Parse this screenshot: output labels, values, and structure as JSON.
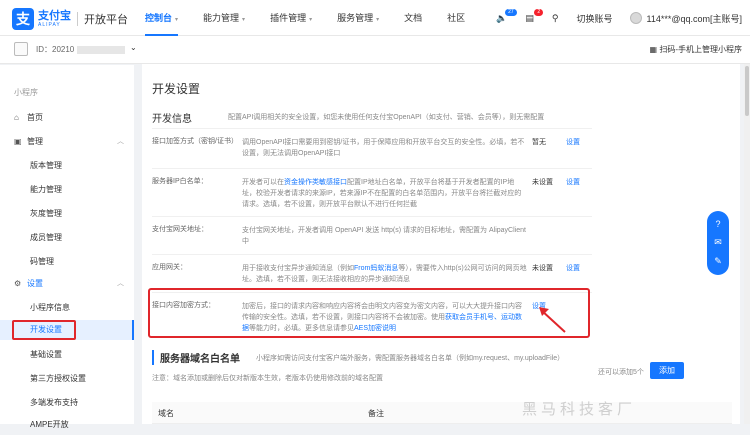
{
  "brand": {
    "name_cn": "支付宝",
    "name_en": "ALIPAY",
    "platform": "开放平台",
    "color": "#1677ff"
  },
  "nav": {
    "items": [
      {
        "label": "控制台",
        "active": true
      },
      {
        "label": "能力管理"
      },
      {
        "label": "插件管理"
      },
      {
        "label": "服务管理"
      },
      {
        "label": "文档"
      },
      {
        "label": "社区"
      }
    ]
  },
  "tools": {
    "notify_count": "27",
    "message_count": "2",
    "switch_account": "切换账号",
    "account": "114***@qq.com[主账号]"
  },
  "app": {
    "id_label": "ID：20210",
    "scan_label": "扫码-手机上管理小程序"
  },
  "sidebar": {
    "section": "小程序",
    "items": [
      {
        "label": "首页",
        "icon": "home-icon"
      },
      {
        "label": "管理",
        "icon": "briefcase-icon"
      },
      {
        "label": "版本管理"
      },
      {
        "label": "能力管理"
      },
      {
        "label": "灰度管理"
      },
      {
        "label": "成员管理"
      },
      {
        "label": "码管理"
      },
      {
        "label": "设置",
        "icon": "gear-icon"
      },
      {
        "label": "小程序信息"
      },
      {
        "label": "开发设置",
        "active": true
      },
      {
        "label": "基础设置"
      },
      {
        "label": "第三方授权设置"
      },
      {
        "label": "多端发布支持"
      },
      {
        "label": "AMPE开放"
      }
    ]
  },
  "main": {
    "page_title": "开发设置",
    "section_title": "开发信息",
    "section_desc": "配置API调用相关的安全设置，如您未使用任何支付宝OpenAPI（如支付、营销、会员等），则无需配置",
    "rows": [
      {
        "label": "接口加签方式（密钥/证书）",
        "desc": "调用OpenAPI接口需要用到密钥/证书，用于保障应用和开放平台交互的安全性。必填，若不设置，则无法调用OpenAPI接口",
        "status": "暂无",
        "action": "设置"
      },
      {
        "label": "服务器IP白名单：",
        "desc_pre": "开发者可以在",
        "desc_link": "资金操作类敏感接口",
        "desc_post": "配置IP地址白名单，开放平台将基于开发者配置的IP地址，校验开发者请求的来源IP，若来源IP不在配置的白名单范围内，开放平台将拦截对应的请求。选填，若不设置，则开放平台默认不进行任何拦截",
        "status": "未设置",
        "action": "设置"
      },
      {
        "label": "支付宝网关地址：",
        "desc": "支付宝网关地址，开发者调用 OpenAPI 发送 http(s) 请求的目标地址，需配置为 AlipayClient中",
        "status": "",
        "action": ""
      },
      {
        "label": "应用网关：",
        "desc_pre": "用于接收支付宝异步通知消息（例如",
        "desc_link": "From蚂蚁消息",
        "desc_post": "等），需要传入http(s)公网可访问的网页地址。选填，若不设置，则无法接收相应的异步通知消息",
        "status": "未设置",
        "action": "设置"
      },
      {
        "label": "接口内容加密方式：",
        "desc_pre": "加密后，接口的请求内容和响应内容将会由明文内容变为密文内容，可以大大提升接口内容传输的安全性。选填，若不设置，则接口内容将不会被加密。使用",
        "desc_link": "获取会员手机号、运动数据",
        "desc_mid": "等能力时，必填。更多信息请参见",
        "desc_link2": "AES加密说明",
        "status": "未设置",
        "action": "设置"
      }
    ],
    "whitelist": {
      "title": "服务器域名白名单",
      "desc": "小程序如需访问支付宝客户端外服务，需配置服务器域名白名单（例如my.request、my.uploadFile）",
      "note": "注意：域名添加或删除后仅对新版本生效，老版本仍使用修改前的域名配置",
      "can_add": "还可以添加5个",
      "add_label": "添加",
      "columns": [
        "域名",
        "备注"
      ]
    }
  },
  "watermark": "黑马科技客厂"
}
